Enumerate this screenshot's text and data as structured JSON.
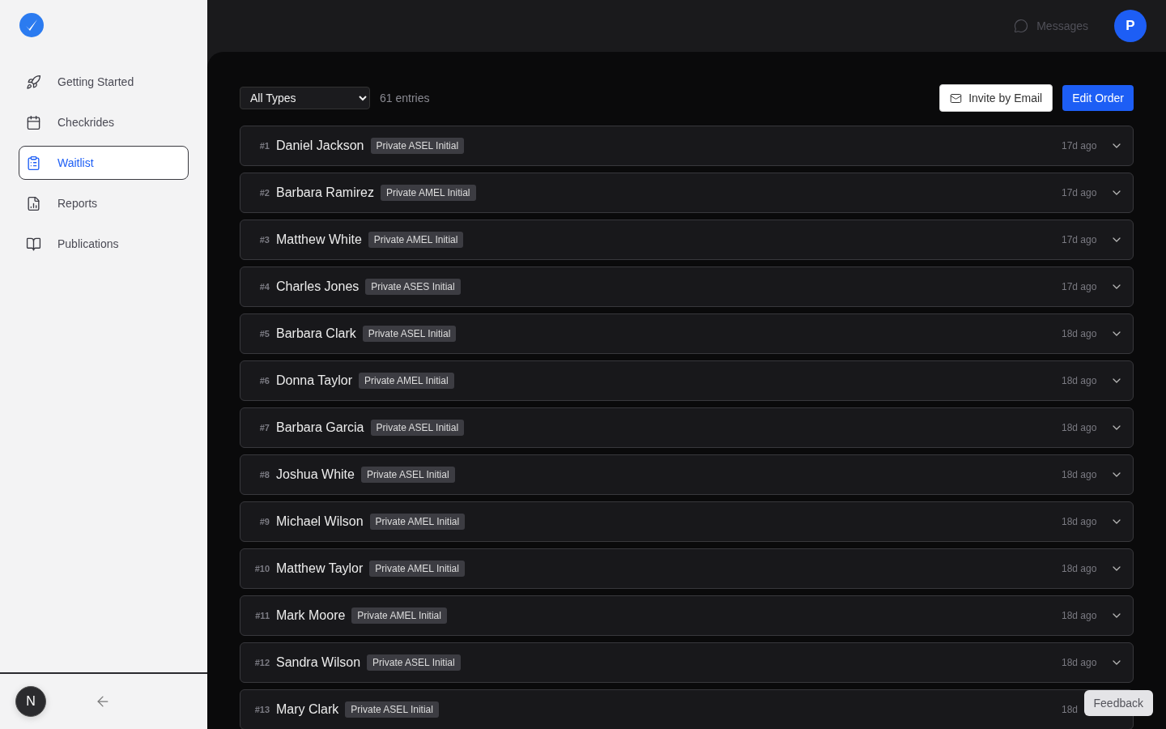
{
  "sidebar": {
    "items": [
      {
        "label": "Getting Started",
        "selected": false
      },
      {
        "label": "Checkrides",
        "selected": false
      },
      {
        "label": "Waitlist",
        "selected": true
      },
      {
        "label": "Reports",
        "selected": false
      },
      {
        "label": "Publications",
        "selected": false
      }
    ],
    "footer_badge": "N"
  },
  "topbar": {
    "messages": "Messages",
    "avatar": "P"
  },
  "toolbar": {
    "filter": "All Types",
    "count": "61 entries",
    "invite_button": "Invite by Email",
    "edit_button": "Edit Order"
  },
  "rows": [
    {
      "number": "#1",
      "name": "Daniel Jackson",
      "tag": "Private ASEL Initial",
      "time": "17d ago"
    },
    {
      "number": "#2",
      "name": "Barbara Ramirez",
      "tag": "Private AMEL Initial",
      "time": "17d ago"
    },
    {
      "number": "#3",
      "name": "Matthew White",
      "tag": "Private AMEL Initial",
      "time": "17d ago"
    },
    {
      "number": "#4",
      "name": "Charles Jones",
      "tag": "Private ASES Initial",
      "time": "17d ago"
    },
    {
      "number": "#5",
      "name": "Barbara Clark",
      "tag": "Private ASEL Initial",
      "time": "18d ago"
    },
    {
      "number": "#6",
      "name": "Donna Taylor",
      "tag": "Private AMEL Initial",
      "time": "18d ago"
    },
    {
      "number": "#7",
      "name": "Barbara Garcia",
      "tag": "Private ASEL Initial",
      "time": "18d ago"
    },
    {
      "number": "#8",
      "name": "Joshua White",
      "tag": "Private ASEL Initial",
      "time": "18d ago"
    },
    {
      "number": "#9",
      "name": "Michael Wilson",
      "tag": "Private AMEL Initial",
      "time": "18d ago"
    },
    {
      "number": "#10",
      "name": "Matthew Taylor",
      "tag": "Private AMEL Initial",
      "time": "18d ago"
    },
    {
      "number": "#11",
      "name": "Mark Moore",
      "tag": "Private AMEL Initial",
      "time": "18d ago"
    },
    {
      "number": "#12",
      "name": "Sandra Wilson",
      "tag": "Private ASEL Initial",
      "time": "18d ago"
    },
    {
      "number": "#13",
      "name": "Mary Clark",
      "tag": "Private ASEL Initial",
      "time": "18d"
    }
  ],
  "feedback_button": "Feedback"
}
